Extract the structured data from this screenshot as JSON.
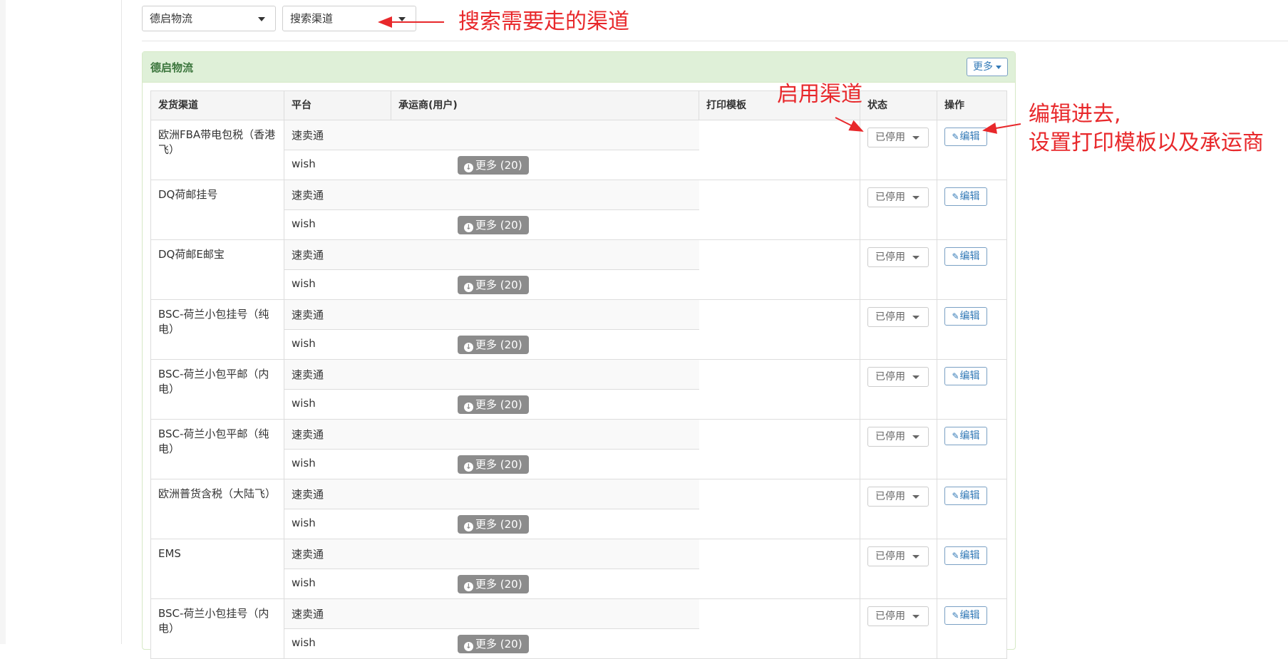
{
  "filters": {
    "company_select": "德启物流",
    "channel_select": "搜索渠道"
  },
  "panel": {
    "title": "德启物流",
    "more_label": "更多"
  },
  "table": {
    "headers": [
      "发货渠道",
      "平台",
      "承运商(用户)",
      "打印模板",
      "状态",
      "操作"
    ],
    "rows": [
      {
        "channel": "欧洲FBA带电包税（香港飞）",
        "platform_top": "速卖通",
        "platform_bottom": "wish",
        "more": "更多 (20)",
        "status": "已停用",
        "edit": "编辑"
      },
      {
        "channel": "DQ荷邮挂号",
        "platform_top": "速卖通",
        "platform_bottom": "wish",
        "more": "更多 (20)",
        "status": "已停用",
        "edit": "编辑"
      },
      {
        "channel": "DQ荷邮E邮宝",
        "platform_top": "速卖通",
        "platform_bottom": "wish",
        "more": "更多 (20)",
        "status": "已停用",
        "edit": "编辑"
      },
      {
        "channel": "BSC-荷兰小包挂号（纯电）",
        "platform_top": "速卖通",
        "platform_bottom": "wish",
        "more": "更多 (20)",
        "status": "已停用",
        "edit": "编辑"
      },
      {
        "channel": "BSC-荷兰小包平邮（内电）",
        "platform_top": "速卖通",
        "platform_bottom": "wish",
        "more": "更多 (20)",
        "status": "已停用",
        "edit": "编辑"
      },
      {
        "channel": "BSC-荷兰小包平邮（纯电）",
        "platform_top": "速卖通",
        "platform_bottom": "wish",
        "more": "更多 (20)",
        "status": "已停用",
        "edit": "编辑"
      },
      {
        "channel": "欧洲普货含税（大陆飞）",
        "platform_top": "速卖通",
        "platform_bottom": "wish",
        "more": "更多 (20)",
        "status": "已停用",
        "edit": "编辑"
      },
      {
        "channel": "EMS",
        "platform_top": "速卖通",
        "platform_bottom": "wish",
        "more": "更多 (20)",
        "status": "已停用",
        "edit": "编辑"
      },
      {
        "channel": "BSC-荷兰小包挂号（内电）",
        "platform_top": "速卖通",
        "platform_bottom": "wish",
        "more": "更多 (20)",
        "status": "已停用",
        "edit": "编辑"
      }
    ]
  },
  "annotations": {
    "search_channel": "搜索需要走的渠道",
    "enable_channel": "启用渠道",
    "edit_line1": "编辑进去,",
    "edit_line2": "设置打印模板以及承运商"
  },
  "colors": {
    "annotation": "#e8282b",
    "panel_header": "#dff0d8",
    "badge": "#8c8c8c",
    "link": "#337ab7"
  }
}
